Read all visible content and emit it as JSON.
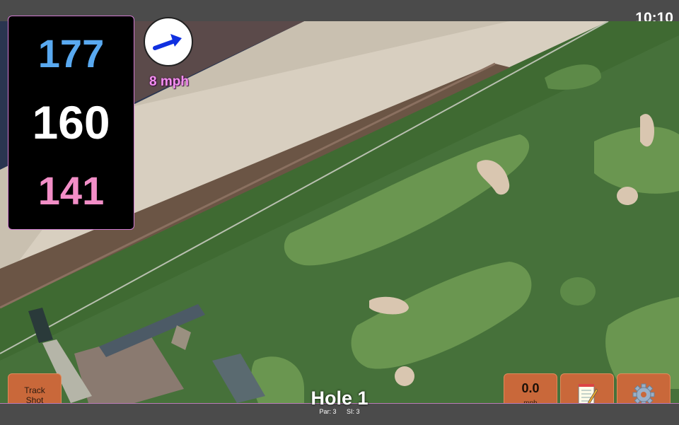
{
  "status_bar": {
    "time": "10:10"
  },
  "distances": {
    "back": "177",
    "middle": "160",
    "front": "141"
  },
  "wind": {
    "speed": "8 mph",
    "icon": "wind-arrow-icon"
  },
  "hole": {
    "title": "Hole 1",
    "par": "Par: 3",
    "stroke_index": "SI: 3"
  },
  "buttons": {
    "track_shot_line1": "Track",
    "track_shot_line2": "Shot",
    "speed_value": "0.0",
    "speed_unit": "mph",
    "notes_icon": "notepad-icon",
    "settings_icon": "gear-icon"
  },
  "colors": {
    "back": "#59a9f0",
    "middle": "#ffffff",
    "front": "#f28ec7",
    "button": "#c9683a",
    "accent": "#d27bd2"
  }
}
